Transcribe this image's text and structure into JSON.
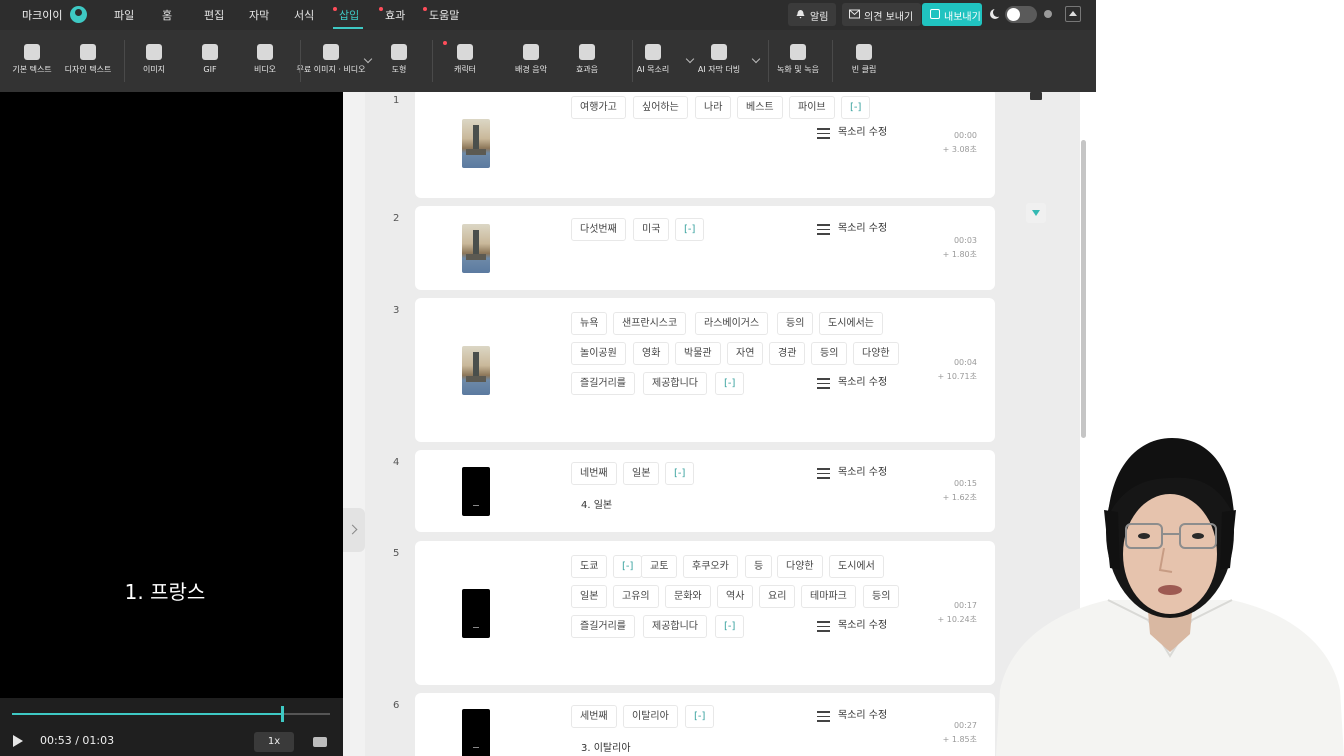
{
  "app": {
    "brand": "마크이이"
  },
  "menu": [
    {
      "label": "파일",
      "dot": false,
      "active": false
    },
    {
      "label": "홈",
      "dot": false,
      "active": false
    },
    {
      "label": "편집",
      "dot": false,
      "active": false
    },
    {
      "label": "자막",
      "dot": false,
      "active": false
    },
    {
      "label": "서식",
      "dot": false,
      "active": false
    },
    {
      "label": "삽입",
      "dot": true,
      "active": true
    },
    {
      "label": "효과",
      "dot": true,
      "active": false
    },
    {
      "label": "도움말",
      "dot": true,
      "active": false
    }
  ],
  "topbar": {
    "notifications": "알림",
    "feedback": "의견 보내기",
    "export": "내보내기"
  },
  "toolbar": [
    {
      "label": "기본 텍스트",
      "icon": "text-icon"
    },
    {
      "label": "디자인 텍스트",
      "icon": "design-text-icon"
    },
    {
      "label": "이미지",
      "icon": "image-icon"
    },
    {
      "label": "GIF",
      "icon": "gif-icon"
    },
    {
      "label": "비디오",
      "icon": "video-icon"
    },
    {
      "label": "무료 이미지 · 비디오",
      "icon": "stock-media-icon"
    },
    {
      "label": "도형",
      "icon": "shape-icon"
    },
    {
      "label": "캐릭터",
      "icon": "character-icon"
    },
    {
      "label": "배경 음악",
      "icon": "music-icon"
    },
    {
      "label": "효과음",
      "icon": "sound-effect-icon"
    },
    {
      "label": "AI 목소리",
      "icon": "ai-voice-icon"
    },
    {
      "label": "AI 자막 더빙",
      "icon": "ai-dubbing-icon"
    },
    {
      "label": "녹화 및 녹음",
      "icon": "record-icon"
    },
    {
      "label": "빈 클립",
      "icon": "blank-clip-icon"
    }
  ],
  "preview": {
    "caption": "1. 프랑스",
    "time": "00:53 / 01:03",
    "progress": 0.85,
    "speed": "1x"
  },
  "voice_edit_label": "목소리 수정",
  "clips": [
    {
      "num": "1",
      "thumb": "photo",
      "words": [
        [
          "여행가고",
          "싶어하는",
          "나라",
          "베스트",
          "파이브",
          "[-]"
        ]
      ],
      "subtitle": "",
      "time": "00:00",
      "duration": "+ 3.08초"
    },
    {
      "num": "2",
      "thumb": "photo",
      "words": [
        [
          "다섯번째",
          "미국",
          "[-]"
        ]
      ],
      "subtitle": "",
      "time": "00:03",
      "duration": "+ 1.80초"
    },
    {
      "num": "3",
      "thumb": "photo",
      "words": [
        [
          "뉴욕",
          "샌프란시스코",
          "라스베이거스",
          "등의",
          "도시에서는"
        ],
        [
          "놀이공원",
          "영화",
          "박물관",
          "자연",
          "경관",
          "등의",
          "다양한"
        ],
        [
          "즐길거리를",
          "제공합니다",
          "[-]"
        ]
      ],
      "subtitle": "",
      "time": "00:04",
      "duration": "+ 10.71초"
    },
    {
      "num": "4",
      "thumb": "black",
      "words": [
        [
          "네번째",
          "일본",
          "[-]"
        ]
      ],
      "subtitle": "4.  일본",
      "time": "00:15",
      "duration": "+ 1.62초"
    },
    {
      "num": "5",
      "thumb": "black",
      "words": [
        [
          "도쿄",
          "[-]",
          "교토",
          "후쿠오카",
          "등",
          "다양한",
          "도시에서"
        ],
        [
          "일본",
          "고유의",
          "문화와",
          "역사",
          "요리",
          "테마파크",
          "등의"
        ],
        [
          "즐길거리를",
          "제공합니다",
          "[-]"
        ]
      ],
      "subtitle": "",
      "time": "00:17",
      "duration": "+ 10.24초"
    },
    {
      "num": "6",
      "thumb": "black",
      "words": [
        [
          "세번째",
          "이탈리아",
          "[-]"
        ]
      ],
      "subtitle": "3.  이탈리아",
      "time": "00:27",
      "duration": "+ 1.85초"
    }
  ]
}
